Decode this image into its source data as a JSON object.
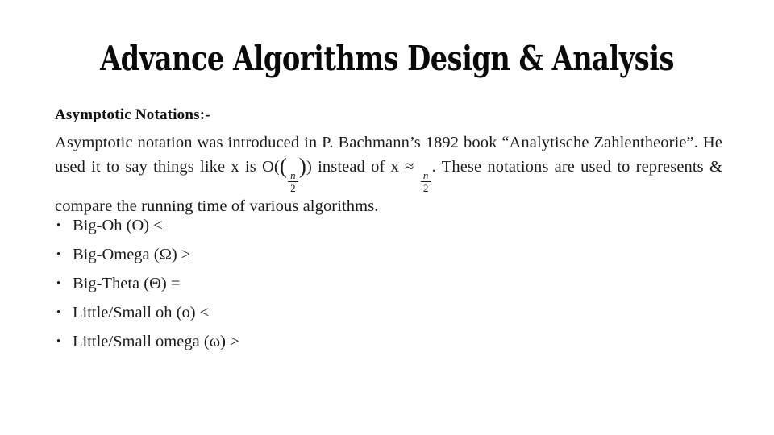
{
  "slide": {
    "title": "Advance Algorithms Design & Analysis",
    "background_color": "#ffffff",
    "text_color": "#1b1b1b"
  },
  "body": {
    "section_heading": "Asymptotic Notations:-",
    "paragraph": {
      "part1": "Asymptotic notation was introduced in P. Bachmann’s 1892 book “Analytische Zahlentheorie”. He used it to say things like x is O(",
      "frac1": {
        "numerator": "n",
        "denominator": "2"
      },
      "part2": ") instead of x ≈ ",
      "frac2": {
        "numerator": "n",
        "denominator": "2"
      },
      "part3": ". These notations are used to represents & compare the running time of various algorithms."
    }
  },
  "bullets": {
    "marker": "•",
    "items": [
      {
        "label": "Big-Oh (O)",
        "symbol": "≤"
      },
      {
        "label": "Big-Omega (Ω)",
        "symbol": "≥"
      },
      {
        "label": "Big-Theta (Θ)",
        "symbol": "="
      },
      {
        "label": "Little/Small oh (o)",
        "symbol": "<"
      },
      {
        "label": "Little/Small omega (ω)",
        "symbol": ">"
      }
    ]
  }
}
